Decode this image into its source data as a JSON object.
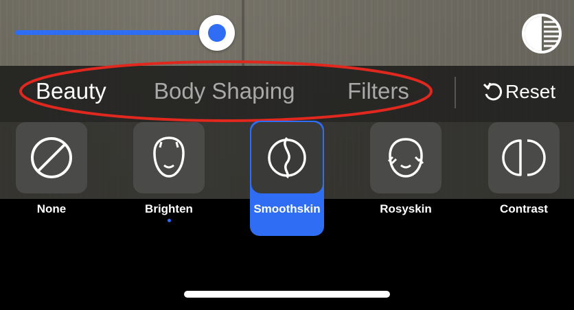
{
  "slider": {
    "value_fraction": 0.92,
    "accent": "#2f6df5"
  },
  "compare_button": {
    "icon": "compare-contrast-icon"
  },
  "tabs": [
    {
      "label": "Beauty",
      "active": true
    },
    {
      "label": "Body Shaping",
      "active": false
    },
    {
      "label": "Filters",
      "active": false
    }
  ],
  "reset": {
    "label": "Reset",
    "icon": "reset-icon"
  },
  "highlight_color": "#e0281e",
  "effects": [
    {
      "label": "None",
      "icon": "none-icon",
      "selected": false,
      "dot": false
    },
    {
      "label": "Brighten",
      "icon": "brighten-face-icon",
      "selected": false,
      "dot": true
    },
    {
      "label": "Smoothskin",
      "icon": "smoothskin-icon",
      "selected": true,
      "dot": false
    },
    {
      "label": "Rosyskin",
      "icon": "rosyskin-face-icon",
      "selected": false,
      "dot": false
    },
    {
      "label": "Contrast",
      "icon": "contrast-icon",
      "selected": false,
      "dot": false
    }
  ]
}
